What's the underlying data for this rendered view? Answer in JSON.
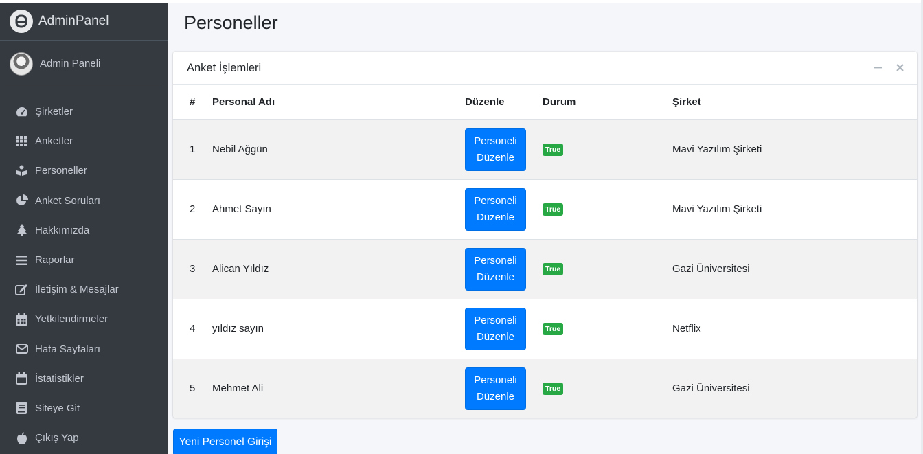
{
  "brand": {
    "name": "AdminPanel"
  },
  "user": {
    "name": "Admin Paneli"
  },
  "sidebar": {
    "items": [
      {
        "label": "Şirketler",
        "icon": "tachometer-icon"
      },
      {
        "label": "Anketler",
        "icon": "grid-icon"
      },
      {
        "label": "Personeller",
        "icon": "reader-icon"
      },
      {
        "label": "Anket Soruları",
        "icon": "pie-chart-icon"
      },
      {
        "label": "Hakkımızda",
        "icon": "tree-icon"
      },
      {
        "label": "Raporlar",
        "icon": "list-icon"
      },
      {
        "label": "İletişim & Mesajlar",
        "icon": "edit-icon"
      },
      {
        "label": "Yetkilendirmeler",
        "icon": "calendar-icon"
      },
      {
        "label": "Hata Sayfaları",
        "icon": "envelope-icon"
      },
      {
        "label": "İstatistikler",
        "icon": "calendar-blank-icon"
      },
      {
        "label": "Siteye Git",
        "icon": "book-icon"
      },
      {
        "label": "Çıkış Yap",
        "icon": "apple-icon"
      }
    ]
  },
  "page": {
    "title": "Personeller"
  },
  "card": {
    "title": "Anket İşlemleri"
  },
  "table": {
    "headers": [
      "#",
      "Personal Adı",
      "Düzenle",
      "Durum",
      "Şirket"
    ],
    "rows": [
      {
        "num": "1",
        "name": "Nebil Ağgün",
        "edit_line1": "Personeli",
        "edit_line2": "Düzenle",
        "status": "True",
        "company": "Mavi Yazılım Şirketi"
      },
      {
        "num": "2",
        "name": "Ahmet Sayın",
        "edit_line1": "Personeli",
        "edit_line2": "Düzenle",
        "status": "True",
        "company": "Mavi Yazılım Şirketi"
      },
      {
        "num": "3",
        "name": "Alican Yıldız",
        "edit_line1": "Personeli",
        "edit_line2": "Düzenle",
        "status": "True",
        "company": "Gazi Üniversitesi"
      },
      {
        "num": "4",
        "name": "yıldız sayın",
        "edit_line1": "Personeli",
        "edit_line2": "Düzenle",
        "status": "True",
        "company": "Netflix"
      },
      {
        "num": "5",
        "name": "Mehmet Ali",
        "edit_line1": "Personeli",
        "edit_line2": "Düzenle",
        "status": "True",
        "company": "Gazi Üniversitesi"
      }
    ]
  },
  "actions": {
    "new_button": "Yeni Personel Girişi"
  },
  "colors": {
    "sidebar": "#343a40",
    "primary": "#007bff",
    "success": "#28a745",
    "content_bg": "#f4f6f9"
  }
}
